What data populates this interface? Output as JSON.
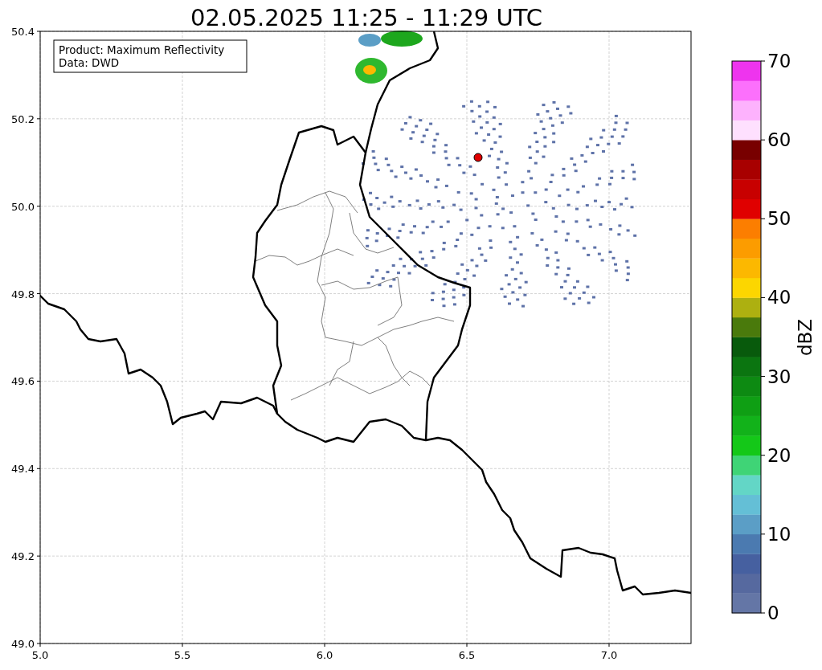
{
  "title": "02.05.2025 11:25 - 11:29 UTC",
  "legend": {
    "lines": [
      "Product: Maximum Reflectivity",
      "Data: DWD"
    ]
  },
  "axes": {
    "yticks": [
      "50.4",
      "50.2",
      "50.0",
      "49.8",
      "49.6",
      "49.4",
      "49.2",
      "49.0"
    ],
    "xticks": [
      "5.0",
      "5.5",
      "6.0",
      "6.5",
      "7.0"
    ]
  },
  "colorbar": {
    "label": "dBZ",
    "ticks": [
      "70",
      "60",
      "50",
      "40",
      "30",
      "20",
      "10",
      "0"
    ],
    "segments": [
      {
        "color": "#6476a6"
      },
      {
        "color": "#56699f"
      },
      {
        "color": "#4660a0"
      },
      {
        "color": "#4b7ab0"
      },
      {
        "color": "#5b9ec6"
      },
      {
        "color": "#64bfd6"
      },
      {
        "color": "#63d6c6"
      },
      {
        "color": "#3fd476"
      },
      {
        "color": "#14c818"
      },
      {
        "color": "#12b21a"
      },
      {
        "color": "#0f9f14"
      },
      {
        "color": "#0d8a12"
      },
      {
        "color": "#0b7510"
      },
      {
        "color": "#085a0c"
      },
      {
        "color": "#4a7a0c"
      },
      {
        "color": "#adb010"
      },
      {
        "color": "#fcd600"
      },
      {
        "color": "#fcb800"
      },
      {
        "color": "#fc9c00"
      },
      {
        "color": "#fc7e00"
      },
      {
        "color": "#e00000"
      },
      {
        "color": "#c80000"
      },
      {
        "color": "#a80000"
      },
      {
        "color": "#780000"
      },
      {
        "color": "#fee0fe"
      },
      {
        "color": "#fdb2fd"
      },
      {
        "color": "#fc70fc"
      },
      {
        "color": "#ee34ee"
      }
    ]
  }
}
